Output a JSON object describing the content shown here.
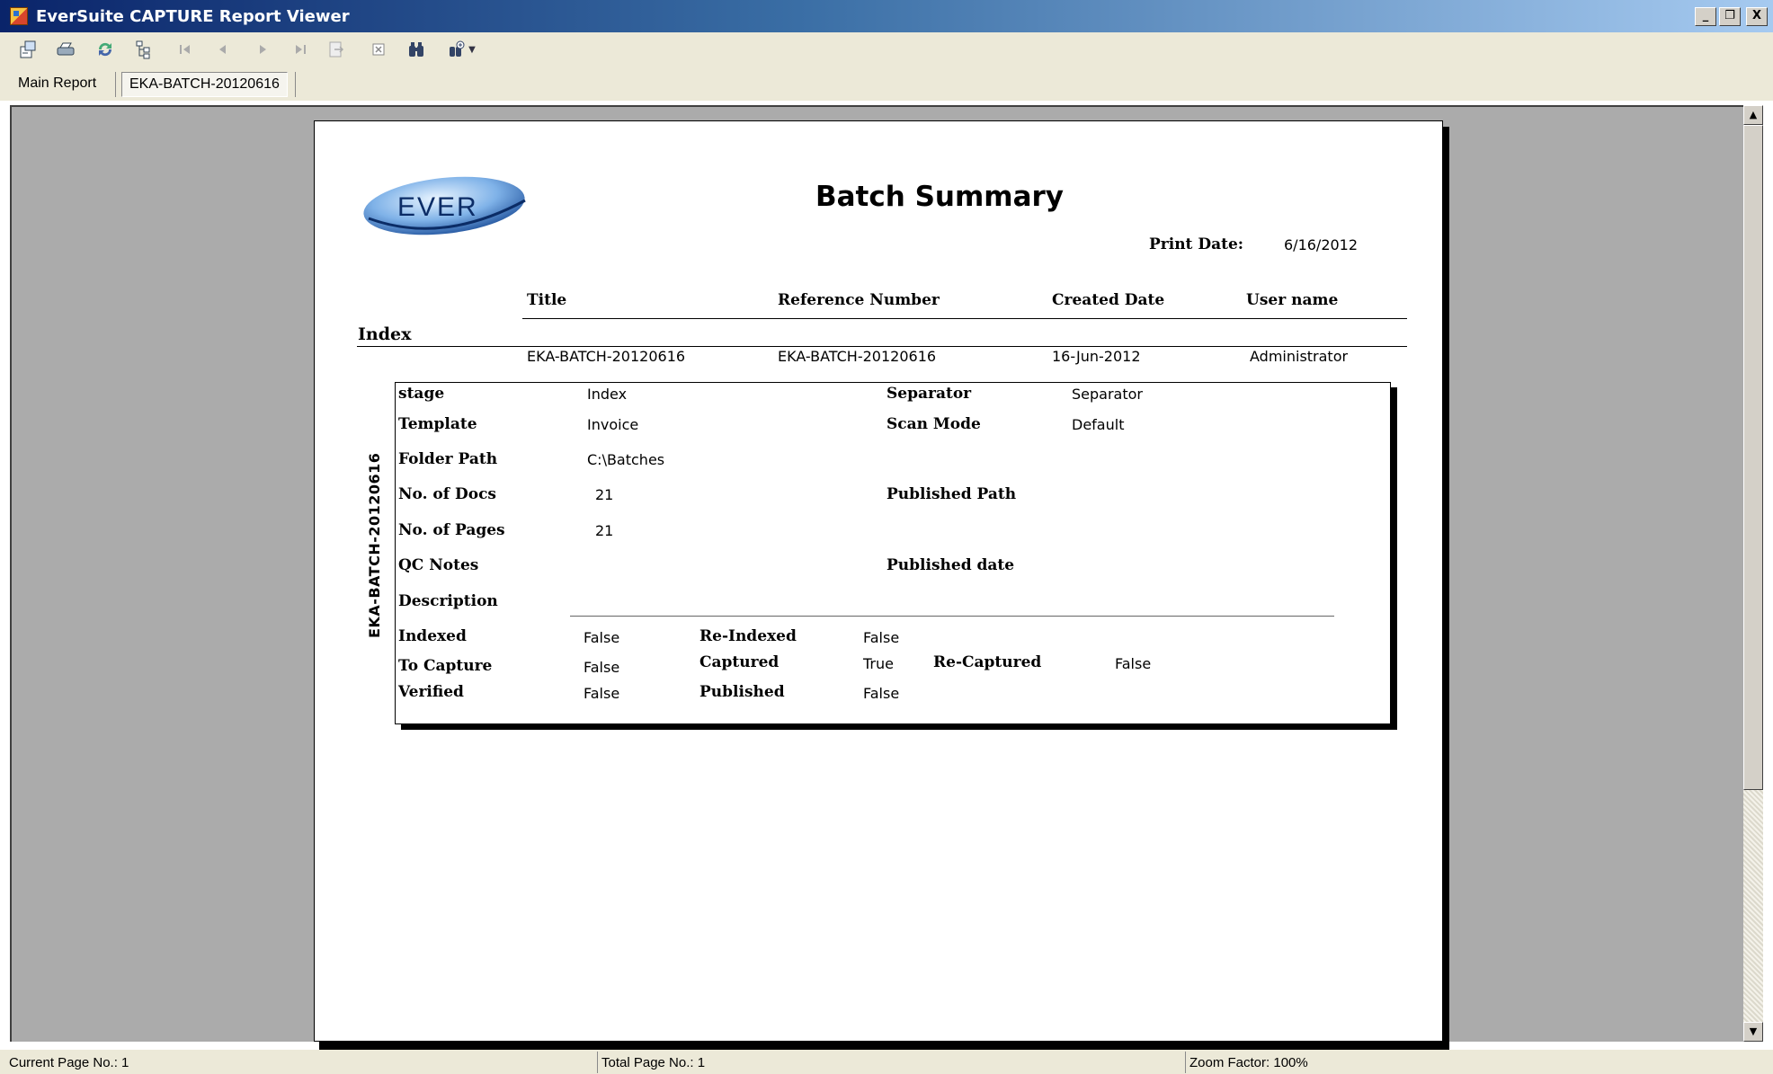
{
  "window": {
    "title": "EverSuite CAPTURE Report Viewer",
    "controls": {
      "minimize": "_",
      "restore": "❐",
      "close": "X"
    }
  },
  "toolbar": {
    "buttons": [
      {
        "name": "export",
        "icon": "export-icon",
        "enabled": true
      },
      {
        "name": "print",
        "icon": "print-icon",
        "enabled": true
      },
      {
        "name": "refresh",
        "icon": "refresh-icon",
        "enabled": true
      },
      {
        "name": "toggle-group-tree",
        "icon": "group-tree-icon",
        "enabled": true
      },
      {
        "name": "first-page",
        "icon": "first-page-icon",
        "enabled": false
      },
      {
        "name": "previous-page",
        "icon": "previous-page-icon",
        "enabled": false
      },
      {
        "name": "next-page",
        "icon": "next-page-icon",
        "enabled": false
      },
      {
        "name": "last-page",
        "icon": "last-page-icon",
        "enabled": false
      },
      {
        "name": "go-to-page",
        "icon": "go-to-page-icon",
        "enabled": false
      },
      {
        "name": "close-view",
        "icon": "close-view-icon",
        "enabled": false
      },
      {
        "name": "find",
        "icon": "binoculars-icon",
        "enabled": true
      },
      {
        "name": "zoom",
        "icon": "zoom-icon",
        "enabled": true
      }
    ]
  },
  "tabs": [
    {
      "label": "Main Report",
      "active": false
    },
    {
      "label": "EKA-BATCH-20120616",
      "active": true
    }
  ],
  "report": {
    "logo_text": "EVER",
    "title": "Batch Summary",
    "print_date_label": "Print Date:",
    "print_date": "6/16/2012",
    "columns": [
      "Title",
      "Reference Number",
      "Created Date",
      "User name"
    ],
    "group_label": "Index",
    "row": {
      "title": "EKA-BATCH-20120616",
      "reference_number": "EKA-BATCH-20120616",
      "created_date": "16-Jun-2012",
      "user_name": "Administrator"
    },
    "side_label": "EKA-BATCH-20120616",
    "details": {
      "stage_label": "stage",
      "stage": "Index",
      "template_label": "Template",
      "template": "Invoice",
      "folder_path_label": "Folder Path",
      "folder_path": "C:\\Batches",
      "no_of_docs_label": "No. of Docs",
      "no_of_docs": "21",
      "no_of_pages_label": "No. of Pages",
      "no_of_pages": "21",
      "qc_notes_label": "QC Notes",
      "description_label": "Description",
      "separator_label": "Separator",
      "separator": "Separator",
      "scan_mode_label": "Scan Mode",
      "scan_mode": "Default",
      "published_path_label": "Published Path",
      "published_date_label": "Published date"
    },
    "flags": {
      "indexed_label": "Indexed",
      "indexed": "False",
      "re_indexed_label": "Re-Indexed",
      "re_indexed": "False",
      "to_capture_label": "To Capture",
      "to_capture": "False",
      "captured_label": "Captured",
      "captured": "True",
      "re_captured_label": "Re-Captured",
      "re_captured": "False",
      "verified_label": "Verified",
      "verified": "False",
      "published_label": "Published",
      "published": "False"
    }
  },
  "status": {
    "current_page": "Current Page No.: 1",
    "total_page": "Total Page No.: 1",
    "zoom": "Zoom Factor: 100%"
  }
}
